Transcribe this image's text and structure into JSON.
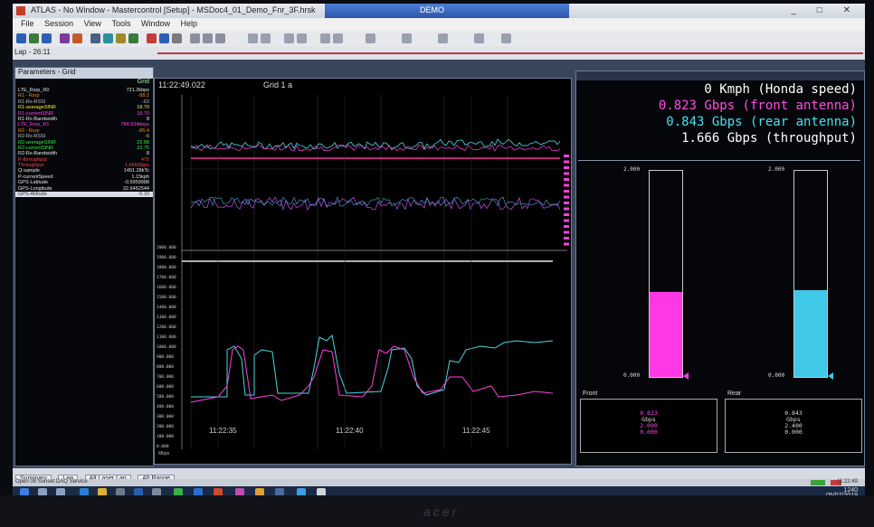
{
  "window": {
    "title": "ATLAS - No Window - Mastercontrol [Setup] - MSDoc4_01_Demo_Fnr_3F.hrsk",
    "center_tab": "DEMO",
    "controls": "_ □ ✕"
  },
  "menu": [
    "File",
    "Session",
    "View",
    "Tools",
    "Window",
    "Help"
  ],
  "toolbar2_tab": "Lap - 26:11",
  "left_panel": {
    "header": "Parameters - Grid",
    "col_header": "Grid",
    "rows": [
      {
        "k": "LTE_Rsrp_R0",
        "v": "721.2kbps",
        "c": "#e6e6e6"
      },
      {
        "k": "R1 - Rsrp",
        "v": "-88.2",
        "c": "#ff8c00"
      },
      {
        "k": "R1-Rx-RSSI",
        "v": "-63",
        "c": "#c0c0c0"
      },
      {
        "k": "R1-averageSINR",
        "v": "18.70",
        "c": "#ffee33"
      },
      {
        "k": "R1-currentSINR",
        "v": "18.70",
        "c": "#ff44ee"
      },
      {
        "k": "R1-Rx-Bandwidth",
        "v": "8",
        "c": "#e6e6e6"
      },
      {
        "k": "LTE_Rsrp_R1",
        "v": "784.634kbps",
        "c": "#ff44ee"
      },
      {
        "k": "R2 - Rsrp",
        "v": "-85.4",
        "c": "#ff8c00"
      },
      {
        "k": "R2-Rx-RSSI",
        "v": "-6",
        "c": "#c0c0c0"
      },
      {
        "k": "R2-averageSINR",
        "v": "22.88",
        "c": "#33ee44"
      },
      {
        "k": "R2-currentSINR",
        "v": "22.75",
        "c": "#33ee44"
      },
      {
        "k": "R2-Rx-Bandwidth",
        "v": "8",
        "c": "#e6e6e6"
      },
      {
        "k": "P-throughput",
        "v": "475",
        "c": "#ff4444"
      },
      {
        "k": "Throughput",
        "v": "1.666Gbps",
        "c": "#ff4444"
      },
      {
        "k": "Q-sample",
        "v": "1451.28kTc",
        "c": "#e6e6e6"
      },
      {
        "k": "P-currentSpeed",
        "v": "1.15kph",
        "c": "#e6e6e6"
      },
      {
        "k": "GPS-Latitude",
        "v": "-0.5959988",
        "c": "#e6e6e6"
      },
      {
        "k": "GPS-Longitude",
        "v": "22.6462544",
        "c": "#e6e6e6"
      },
      {
        "k": "GPS-Altitude",
        "v": "-5.10",
        "c": "#333333",
        "sel": true
      }
    ]
  },
  "graph": {
    "time": "11:22:49.022",
    "grid_label": "Grid 1 a",
    "unit_label": "Mbps",
    "lower_y_labels": [
      "2000.000",
      "1900.000",
      "1800.000",
      "1700.000",
      "1600.000",
      "1500.000",
      "1400.000",
      "1300.000",
      "1200.000",
      "1100.000",
      "1000.000",
      "900.000",
      "800.000",
      "700.000",
      "600.000",
      "500.000",
      "400.000",
      "300.000",
      "200.000",
      "100.000",
      "0.000"
    ],
    "x_labels": [
      "11:22:35",
      "11:22:40",
      "11:22:45"
    ]
  },
  "readouts": [
    {
      "text": "    0 Kmph (Honda speed)",
      "color": "#ffffff"
    },
    {
      "text": "0.823 Gbps (front antenna)",
      "color": "#ff4fe0"
    },
    {
      "text": "0.843 Gbps (rear antenna)",
      "color": "#48e0f0"
    },
    {
      "text": "1.666 Gbps (throughput)",
      "color": "#ffffff"
    }
  ],
  "bars": [
    {
      "name": "front",
      "top_label": "2.000",
      "bottom_label": "0.000",
      "value": 0.823,
      "max": 2.0,
      "color": "#ff38e6"
    },
    {
      "name": "rear",
      "top_label": "2.000",
      "bottom_label": "0.000",
      "value": 0.843,
      "max": 2.0,
      "color": "#3fc8e8"
    }
  ],
  "front_box": {
    "title": "Front",
    "line1": "0.823",
    "line2": "Gbps",
    "line3": "2.000",
    "line4": "0.000"
  },
  "rear_box": {
    "title": "Rear",
    "line1": "0.843",
    "line2": "Gbps",
    "line3": "2.400",
    "line4": "0.000"
  },
  "bottom_tabs": [
    "Summary",
    "Lap",
    "Alt Laser Lap",
    "Alt Range"
  ],
  "status": {
    "message": "Open 08 Sunset DAQ Service",
    "right": "11:22:49"
  },
  "tray": {
    "time": "1240",
    "date": "05/07/2019"
  },
  "brand": "acer"
}
